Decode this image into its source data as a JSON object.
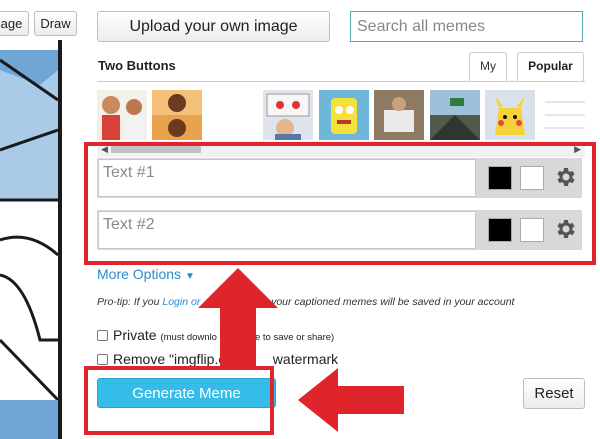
{
  "toolbar": {
    "image_btn_label": "age",
    "draw_btn_label": "Draw",
    "upload_label": "Upload your own image",
    "search_placeholder": "Search all memes"
  },
  "template": {
    "title": "Two Buttons",
    "tabs": [
      {
        "label": "My",
        "active": false
      },
      {
        "label": "Popular",
        "active": true
      }
    ]
  },
  "text_boxes": [
    {
      "placeholder": "Text #1",
      "outline_color": "#000000",
      "fill_color": "#ffffff"
    },
    {
      "placeholder": "Text #2",
      "outline_color": "#000000",
      "fill_color": "#ffffff"
    }
  ],
  "options": {
    "more_options_label": "More Options",
    "protip_prefix": "Pro-tip: If you",
    "protip_link_login": "Login or",
    "protip_hidden": "",
    "protip_suffix": ", your captioned memes will be saved in your account",
    "private_label": "Private",
    "private_note": "(must downlo",
    "private_note_tail": "e to save or share)",
    "remove_label": "Remove \"imgflip.com",
    "remove_tail": "watermark"
  },
  "actions": {
    "generate_label": "Generate Meme",
    "reset_label": "Reset"
  },
  "colors": {
    "accent": "#33bde8",
    "annotation_red": "#e0242c",
    "link": "#2a8bd0"
  }
}
